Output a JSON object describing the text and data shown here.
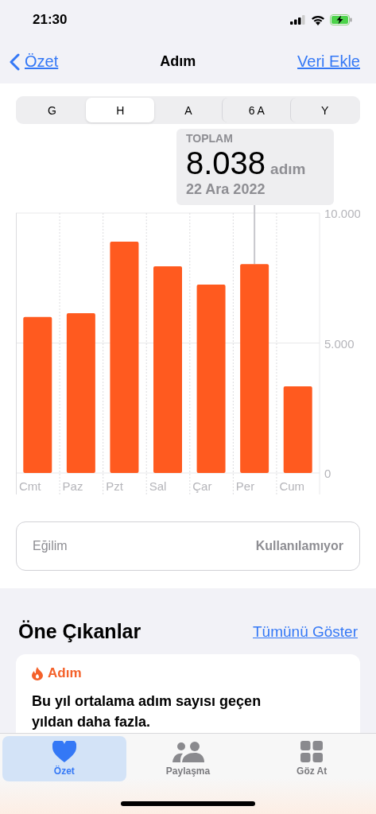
{
  "status_bar": {
    "time": "21:30"
  },
  "nav": {
    "back": "Özet",
    "title": "Adım",
    "action": "Veri Ekle"
  },
  "segments": [
    {
      "label": "G",
      "selected": false
    },
    {
      "label": "H",
      "selected": true
    },
    {
      "label": "A",
      "selected": false
    },
    {
      "label": "6 A",
      "selected": false
    },
    {
      "label": "Y",
      "selected": false
    }
  ],
  "chart": {
    "callout": {
      "caption": "TOPLAM",
      "value": "8.038",
      "unit": "adım",
      "date": "22 Ara 2022"
    },
    "chart_data": {
      "type": "bar",
      "categories": [
        "Cmt",
        "Paz",
        "Pzt",
        "Sal",
        "Çar",
        "Per",
        "Cum"
      ],
      "ylim": [
        0,
        10000
      ],
      "yticks": [
        {
          "value": 0,
          "label": "0"
        },
        {
          "value": 5000,
          "label": "5.000"
        },
        {
          "value": 10000,
          "label": "10.000"
        }
      ],
      "series": [
        {
          "color": "#ff5a1f",
          "values": [
            6000,
            6150,
            8900,
            7950,
            7250,
            8038,
            3330
          ]
        }
      ]
    }
  },
  "trend": {
    "label": "Eğilim",
    "value": "Kullanılamıyor"
  },
  "highlights": {
    "title": "Öne Çıkanlar",
    "link": "Tümünü Göster",
    "cards": [
      {
        "category": "Adım",
        "text": "Bu yıl ortalama adım sayısı geçen yıldan daha fazla."
      }
    ]
  },
  "tab_bar": [
    {
      "kind": "heart",
      "label": "Özet",
      "selected": true
    },
    {
      "kind": "people",
      "label": "Paylaşma",
      "selected": false
    },
    {
      "kind": "grid",
      "label": "Göz At",
      "selected": false
    }
  ]
}
